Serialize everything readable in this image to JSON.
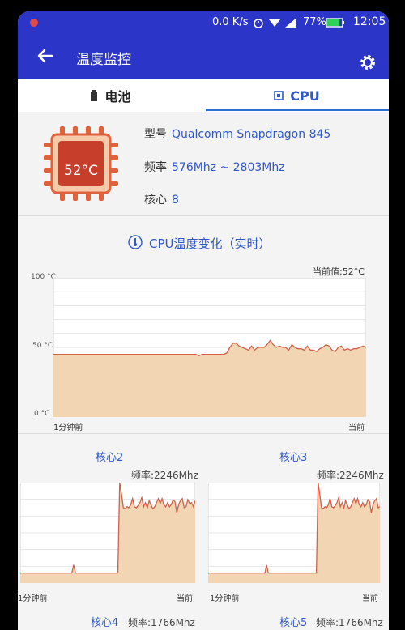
{
  "status": {
    "speed": "0.0 K/s",
    "battery": "77%",
    "time": "12:05"
  },
  "appbar": {
    "title": "温度监控"
  },
  "tabs": [
    {
      "label": "电池",
      "active": false
    },
    {
      "label": "CPU",
      "active": true
    }
  ],
  "cpu": {
    "temperature": "52°C",
    "model_label": "型号",
    "model": "Qualcomm Snapdragon 845",
    "freq_label": "频率",
    "freq": "576Mhz ~ 2803Mhz",
    "cores_label": "核心",
    "cores": "8"
  },
  "main_chart": {
    "title": "CPU温度变化（实时）",
    "current": "当前值:52°C",
    "y_ticks": [
      "100 °C",
      "50 °C",
      "0 °C"
    ],
    "x_start": "1分钟前",
    "x_end": "当前",
    "chart_data": {
      "type": "area",
      "ylim": [
        0,
        100
      ],
      "values": [
        45,
        45,
        45,
        45,
        45,
        45,
        45,
        45,
        45,
        45,
        45,
        45,
        45,
        45,
        45,
        45,
        45,
        45,
        45,
        45,
        45,
        45,
        45,
        45,
        45,
        45,
        45,
        45,
        45,
        45,
        45,
        45,
        45,
        45,
        45,
        45,
        45,
        45,
        45,
        45,
        45,
        45,
        45,
        45,
        45,
        45,
        45,
        44,
        45,
        45,
        45,
        45,
        45,
        45,
        45,
        45,
        46,
        50,
        53,
        53,
        51,
        50,
        49,
        48,
        51,
        48,
        50,
        50,
        50,
        52,
        55,
        52,
        50,
        51,
        50,
        50,
        48,
        52,
        50,
        49,
        49,
        48,
        51,
        48,
        48,
        47,
        49,
        50,
        52,
        51,
        48,
        47,
        50,
        51,
        48,
        49,
        48,
        49,
        49,
        50,
        51,
        50
      ]
    }
  },
  "cores": [
    {
      "title": "核心2",
      "freq": "频率:2246Mhz",
      "x_start": "1分钟前",
      "x_end": "当前",
      "chart_data": {
        "type": "area",
        "ylim": [
          0,
          100
        ],
        "values": [
          10,
          10,
          10,
          10,
          10,
          10,
          10,
          10,
          10,
          10,
          10,
          10,
          10,
          10,
          10,
          10,
          10,
          10,
          10,
          10,
          10,
          10,
          10,
          10,
          10,
          10,
          10,
          10,
          10,
          18,
          10,
          10,
          10,
          10,
          10,
          10,
          10,
          10,
          10,
          10,
          10,
          10,
          10,
          10,
          10,
          10,
          10,
          10,
          10,
          10,
          10,
          10,
          10,
          10,
          100,
          88,
          75,
          74,
          76,
          75,
          78,
          84,
          76,
          75,
          77,
          80,
          85,
          76,
          80,
          75,
          82,
          78,
          74,
          76,
          80,
          84,
          79,
          84,
          78,
          76,
          80,
          76,
          78,
          83,
          81,
          70,
          78,
          82,
          84,
          75,
          76,
          83,
          79,
          80,
          76,
          82
        ]
      }
    },
    {
      "title": "核心3",
      "freq": "频率:2246Mhz",
      "x_start": "1分钟前",
      "x_end": "当前",
      "chart_data": {
        "type": "area",
        "ylim": [
          0,
          100
        ],
        "values": [
          10,
          10,
          10,
          10,
          10,
          10,
          10,
          10,
          10,
          10,
          10,
          10,
          10,
          10,
          10,
          10,
          10,
          10,
          10,
          10,
          10,
          10,
          10,
          10,
          10,
          10,
          10,
          10,
          10,
          10,
          10,
          10,
          10,
          10,
          18,
          10,
          10,
          10,
          10,
          10,
          10,
          10,
          10,
          10,
          10,
          10,
          10,
          10,
          10,
          10,
          10,
          10,
          10,
          10,
          10,
          10,
          10,
          10,
          10,
          10,
          10,
          10,
          10,
          10,
          100,
          88,
          75,
          74,
          76,
          75,
          78,
          84,
          76,
          75,
          77,
          80,
          85,
          76,
          80,
          75,
          82,
          78,
          74,
          76,
          80,
          84,
          79,
          84,
          78,
          76,
          80,
          76,
          78,
          83,
          81,
          70,
          78,
          82,
          84,
          75,
          76
        ]
      }
    },
    {
      "title": "核心4",
      "freq": "频率:1766Mhz"
    },
    {
      "title": "核心5",
      "freq": "频率:1766Mhz"
    }
  ]
}
